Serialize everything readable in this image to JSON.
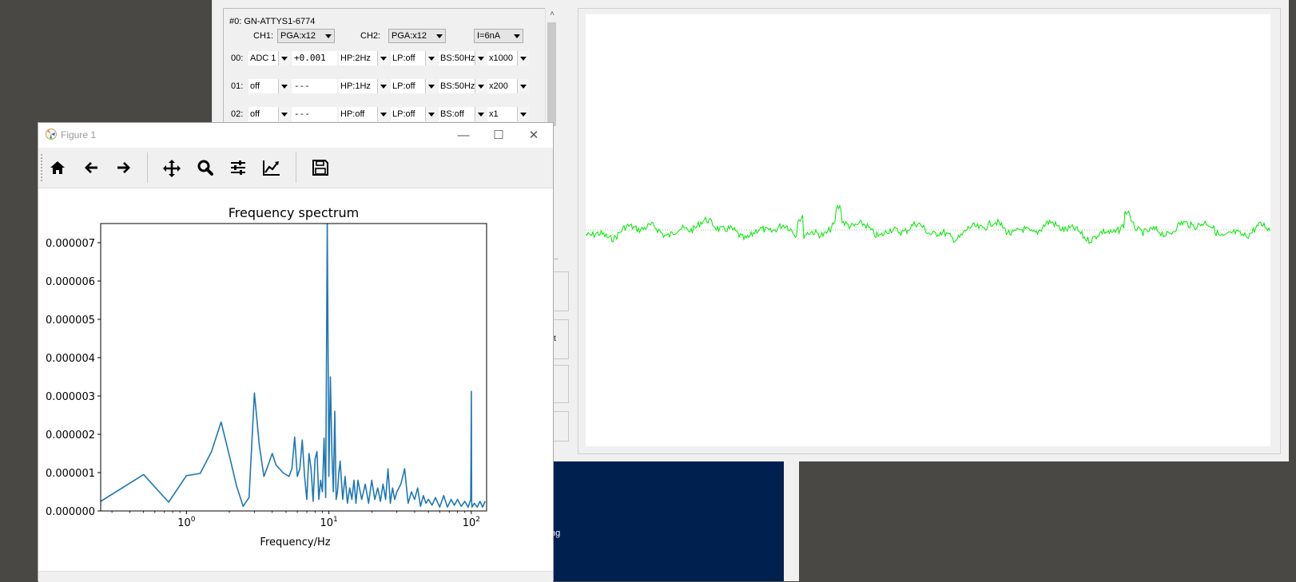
{
  "background_app": {
    "device_title": "#0: GN-ATTYS1-6774",
    "ch1_label": "CH1:",
    "ch1_value": "PGA:x12",
    "ch2_label": "CH2:",
    "ch2_value": "PGA:x12",
    "current_value": "I=6nA",
    "channels": [
      {
        "num": "00:",
        "source": "ADC 1",
        "value": "+0.001",
        "hp": "HP:2Hz",
        "lp": "LP:off",
        "bs": "BS:50Hz",
        "gain": "x1000"
      },
      {
        "num": "01:",
        "source": "off",
        "value": "---",
        "hp": "HP:1Hz",
        "lp": "LP:off",
        "bs": "BS:50Hz",
        "gain": "x200"
      },
      {
        "num": "02:",
        "source": "off",
        "value": "---",
        "hp": "HP:off",
        "lp": "LP:off",
        "bs": "BS:off",
        "gain": "x1"
      }
    ],
    "side_button_text": "st",
    "navy_panel_text": "ng",
    "trace_color": "#00e600"
  },
  "figure": {
    "window_title": "Figure 1",
    "toolbar_icons": [
      "home-icon",
      "back-arrow-icon",
      "forward-arrow-icon",
      "pan-icon",
      "zoom-icon",
      "configure-subplots-icon",
      "edit-axis-icon",
      "save-icon"
    ]
  },
  "chart_data": {
    "type": "line",
    "title": "Frequency spectrum",
    "xlabel": "Frequency/Hz",
    "ylabel": "",
    "x_scale": "log",
    "xlim": [
      0.25,
      128
    ],
    "ylim": [
      0,
      7.5e-06
    ],
    "x_tick_labels": [
      "10^0",
      "10^1",
      "10^2"
    ],
    "y_tick_labels": [
      "0.000000",
      "0.000001",
      "0.000002",
      "0.000003",
      "0.000004",
      "0.000005",
      "0.000006",
      "0.000007"
    ],
    "line_color": "#1f77b4",
    "series": [
      {
        "x": [
          0.25,
          0.5,
          0.75,
          1.0,
          1.25,
          1.5,
          1.75,
          2.0,
          2.25,
          2.5,
          2.75,
          3.0,
          3.25,
          3.5,
          3.75,
          4.0,
          4.25,
          4.5,
          4.75,
          5.0,
          5.25,
          5.5,
          5.75,
          6.0,
          6.25,
          6.5,
          6.75,
          7.0,
          7.25,
          7.5,
          7.75,
          8.0,
          8.25,
          8.5,
          8.75,
          9.0,
          9.25,
          9.5,
          9.75,
          10.0,
          10.25,
          10.5,
          10.75,
          11.0,
          11.25,
          11.5,
          11.75,
          12.0,
          12.5,
          13.0,
          13.5,
          14.0,
          14.5,
          15.0,
          15.5,
          16.0,
          17,
          18,
          19,
          20,
          21,
          22,
          23,
          24,
          25,
          26,
          27,
          28,
          29,
          30,
          32,
          34,
          36,
          38,
          40,
          42,
          44,
          46,
          48,
          50,
          53,
          56,
          60,
          64,
          68,
          72,
          76,
          80,
          85,
          90,
          95,
          99,
          99.5,
          100,
          100.5,
          101,
          105,
          110,
          115,
          120,
          125
        ],
        "y": [
          2.5e-07,
          9.5e-07,
          2.3e-07,
          9.2e-07,
          9.8e-07,
          1.55e-06,
          2.32e-06,
          1.45e-06,
          6.5e-07,
          1.2e-07,
          3.5e-07,
          3.08e-06,
          1.7e-06,
          9e-07,
          1.2e-06,
          1.5e-06,
          1.2e-06,
          1.1e-06,
          1e-06,
          9.5e-07,
          9e-07,
          1.1e-06,
          1.93e-06,
          9e-07,
          1.1e-06,
          1.85e-06,
          9e-07,
          3e-07,
          1.5e-06,
          1.1e-06,
          2.5e-07,
          1.35e-06,
          1.55e-06,
          3e-07,
          8e-07,
          5e-07,
          1.9e-06,
          3.5e-07,
          7.5e-06,
          9e-07,
          3.5e-06,
          1.5e-06,
          5e-07,
          2.6e-06,
          3e-07,
          5e-07,
          1e-06,
          1.3e-06,
          3e-07,
          9e-07,
          2e-07,
          6e-07,
          3e-07,
          8e-07,
          2e-07,
          8e-07,
          3e-07,
          7e-07,
          2e-07,
          8e-07,
          3e-07,
          6e-07,
          2.5e-07,
          7e-07,
          3e-07,
          1.1e-06,
          2e-07,
          6e-07,
          3e-07,
          5e-07,
          7e-07,
          1.1e-06,
          2e-07,
          5e-07,
          3e-07,
          6e-07,
          1.2e-07,
          4e-07,
          2e-07,
          3e-07,
          1.5e-07,
          3.5e-07,
          1e-07,
          4e-07,
          1e-07,
          3e-07,
          1.5e-07,
          3e-07,
          1.2e-07,
          2.5e-07,
          1e-07,
          3e-07,
          1.3e-06,
          3.12e-06,
          2.5e-07,
          1e-07,
          2e-07,
          1e-07,
          2.5e-07,
          1e-07,
          2.5e-07
        ]
      }
    ]
  }
}
